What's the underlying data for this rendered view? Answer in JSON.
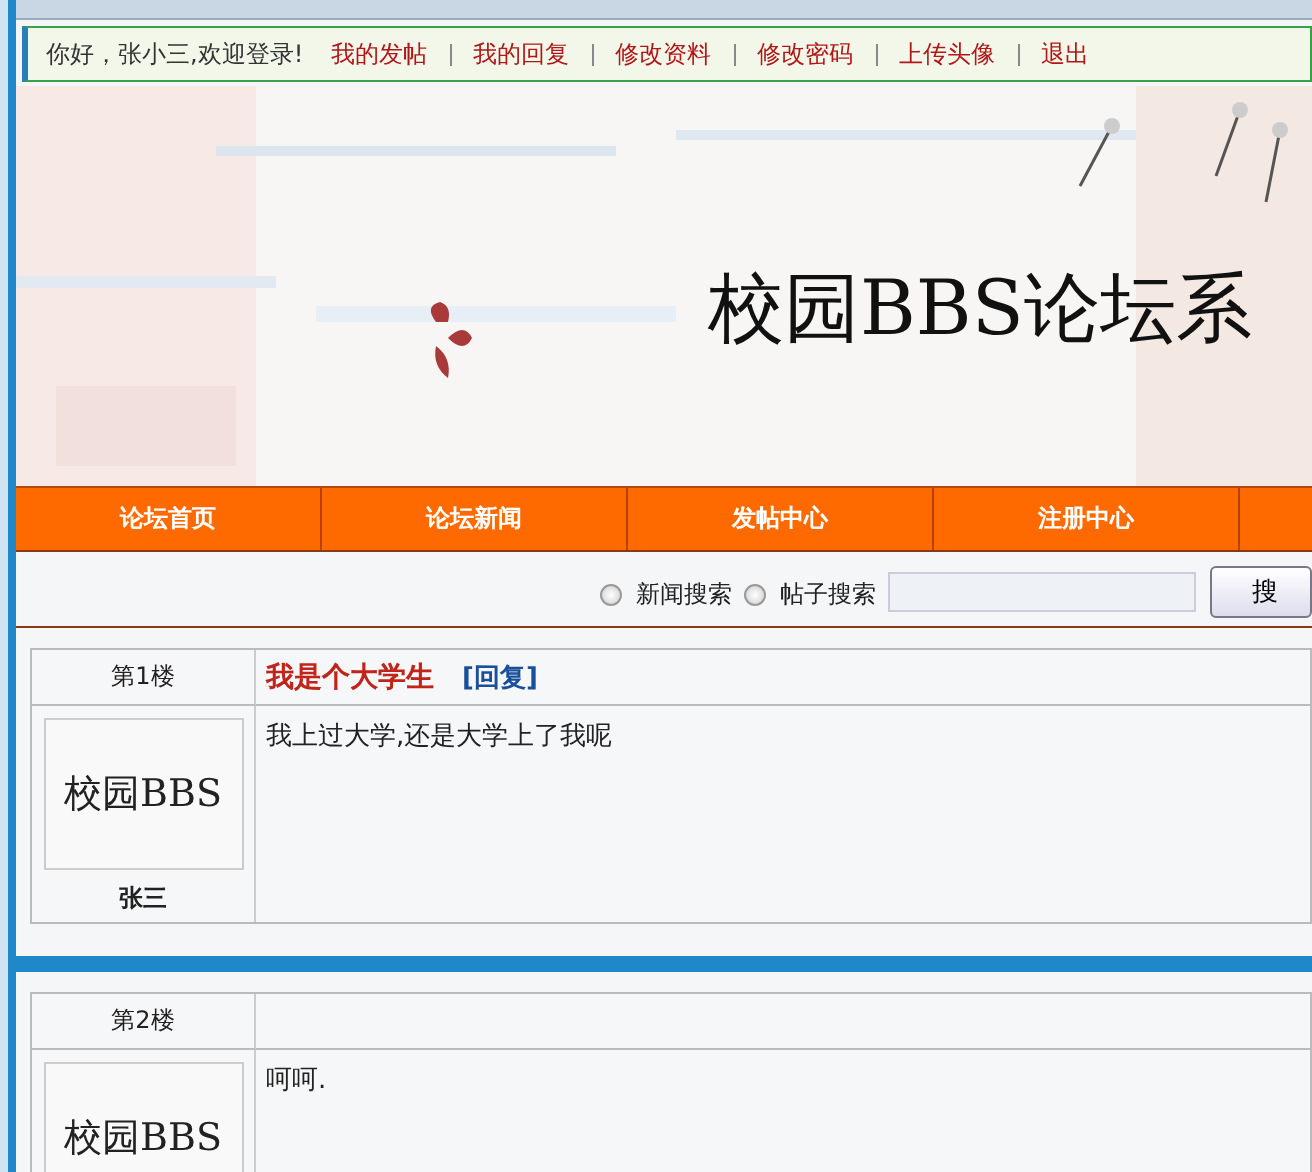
{
  "user_bar": {
    "greeting": "你好，张小三,欢迎登录!",
    "links": [
      "我的发帖",
      "我的回复",
      "修改资料",
      "修改密码",
      "上传头像",
      "退出"
    ]
  },
  "banner": {
    "title": "校园BBS论坛系"
  },
  "nav": {
    "items": [
      "论坛首页",
      "论坛新闻",
      "发帖中心",
      "注册中心"
    ]
  },
  "search": {
    "options": [
      {
        "label": "新闻搜索",
        "selected": false
      },
      {
        "label": "帖子搜索",
        "selected": false
      }
    ],
    "button": "搜"
  },
  "posts": [
    {
      "floor": "第1楼",
      "title": "我是个大学生",
      "reply": "[回复]",
      "avatar": "校园BBS",
      "author": "张三",
      "body": "我上过大学,还是大学上了我呢"
    },
    {
      "floor": "第2楼",
      "avatar": "校园BBS",
      "body": "呵呵."
    }
  ]
}
